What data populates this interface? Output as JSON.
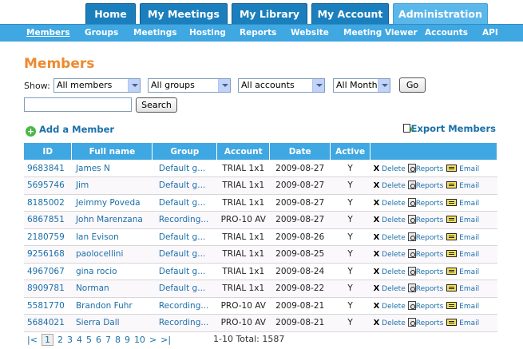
{
  "tabs": [
    {
      "label": "Home"
    },
    {
      "label": "My Meetings"
    },
    {
      "label": "My Library"
    },
    {
      "label": "My Account"
    },
    {
      "label": "Administration"
    }
  ],
  "subnav": [
    {
      "label": "Members"
    },
    {
      "label": "Groups"
    },
    {
      "label": "Meetings"
    },
    {
      "label": "Hosting"
    },
    {
      "label": "Reports"
    },
    {
      "label": "Website"
    },
    {
      "label": "Meeting Viewer"
    },
    {
      "label": "Accounts"
    },
    {
      "label": "API"
    }
  ],
  "page_title": "Members",
  "filters": {
    "show_label": "Show:",
    "members": "All members",
    "groups": "All groups",
    "accounts": "All accounts",
    "months": "All Months",
    "go_label": "Go",
    "search_value": "",
    "search_label": "Search"
  },
  "add_member": "Add a Member",
  "export_members": "Export Members",
  "columns": [
    "ID",
    "Full name",
    "Group",
    "Account",
    "Date",
    "Active"
  ],
  "actions": {
    "delete": "Delete",
    "reports": "Reports",
    "email": "Email"
  },
  "rows": [
    {
      "id": "9683841",
      "name": "James N",
      "group": "Default g...",
      "account": "TRIAL 1x1",
      "date": "2009-08-27",
      "active": "Y"
    },
    {
      "id": "5695746",
      "name": "Jim",
      "group": "Default g...",
      "account": "TRIAL 1x1",
      "date": "2009-08-27",
      "active": "Y"
    },
    {
      "id": "8185002",
      "name": "Jeimmy Poveda",
      "group": "Default g...",
      "account": "TRIAL 1x1",
      "date": "2009-08-27",
      "active": "Y"
    },
    {
      "id": "6867851",
      "name": "John Marenzana",
      "group": "Recording...",
      "account": "PRO-10 AV",
      "date": "2009-08-27",
      "active": "Y"
    },
    {
      "id": "2180759",
      "name": "Ian Evison",
      "group": "Default g...",
      "account": "TRIAL 1x1",
      "date": "2009-08-26",
      "active": "Y"
    },
    {
      "id": "9256168",
      "name": "paolocellini",
      "group": "Default g...",
      "account": "TRIAL 1x1",
      "date": "2009-08-25",
      "active": "Y"
    },
    {
      "id": "4967067",
      "name": "gina rocio",
      "group": "Default g...",
      "account": "TRIAL 1x1",
      "date": "2009-08-24",
      "active": "Y"
    },
    {
      "id": "8909781",
      "name": "Norman",
      "group": "Default g...",
      "account": "TRIAL 1x1",
      "date": "2009-08-22",
      "active": "Y"
    },
    {
      "id": "5581770",
      "name": "Brandon Fuhr",
      "group": "Recording...",
      "account": "PRO-10 AV",
      "date": "2009-08-21",
      "active": "Y"
    },
    {
      "id": "5684021",
      "name": "Sierra Dall",
      "group": "Recording...",
      "account": "PRO-10 AV",
      "date": "2009-08-21",
      "active": "Y"
    }
  ],
  "pager": {
    "first": "|<",
    "pages": [
      "1",
      "2",
      "3",
      "4",
      "5",
      "6",
      "7",
      "8",
      "9",
      "10"
    ],
    "next": ">",
    "last": ">|",
    "current": "1",
    "total": "1-10 Total: 1587"
  }
}
